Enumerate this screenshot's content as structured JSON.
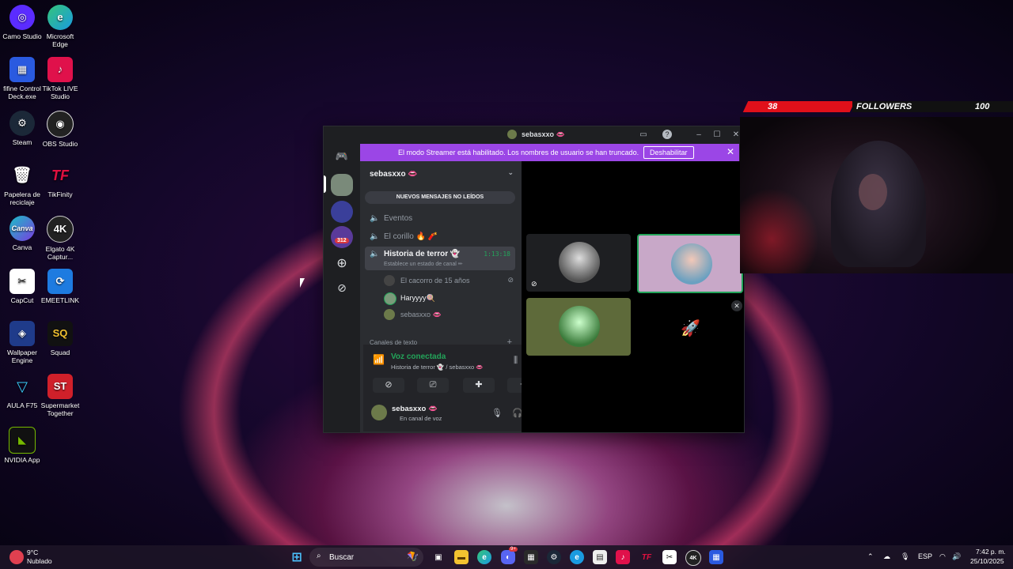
{
  "desktop": {
    "icons": [
      {
        "label": "Camo Studio",
        "bg": "#5b2cff",
        "glyph": "◎"
      },
      {
        "label": "Microsoft Edge",
        "bg": "#1a9be0",
        "glyph": "e"
      },
      {
        "label": "fifine Control Deck.exe",
        "bg": "#2a5ae0",
        "glyph": "▦"
      },
      {
        "label": "TikTok LIVE Studio",
        "bg": "#e0114b",
        "glyph": "♪"
      },
      {
        "label": "Steam",
        "bg": "#1b2838",
        "glyph": "⚙"
      },
      {
        "label": "OBS Studio",
        "bg": "#222",
        "glyph": "◉"
      },
      {
        "label": "Papelera de reciclaje",
        "bg": "#2a3a4a",
        "glyph": "🗑"
      },
      {
        "label": "TikFinity",
        "bg": "#111",
        "glyph": "TF"
      },
      {
        "label": "Canva",
        "bg": "#1ac0c6",
        "glyph": "C"
      },
      {
        "label": "Elgato 4K Captur...",
        "bg": "#222",
        "glyph": "4K"
      },
      {
        "label": "CapCut",
        "bg": "#111",
        "glyph": "✂"
      },
      {
        "label": "EMEETLINK",
        "bg": "#1e7be0",
        "glyph": "⟳"
      },
      {
        "label": "Wallpaper Engine",
        "bg": "#1f3b8a",
        "glyph": "◈"
      },
      {
        "label": "Squad",
        "bg": "#111",
        "glyph": "SQ"
      },
      {
        "label": "AULA F75",
        "bg": "#0a2a4a",
        "glyph": "▽"
      },
      {
        "label": "Supermarket Together",
        "bg": "#d0202a",
        "glyph": "ST"
      },
      {
        "label": "NVIDIA App",
        "bg": "#76b900",
        "glyph": "◣"
      }
    ]
  },
  "discord": {
    "window_title": "sebasxxo 👄",
    "banner": {
      "text": "El modo Streamer está habilitado. Los nombres de usuario se han truncado.",
      "button": "Deshabilitar"
    },
    "guild_badge": "312",
    "server_name": "sebasxxo 👄",
    "new_messages": "NUEVOS MENSAJES NO LEÍDOS",
    "channels": [
      {
        "name": "Eventos"
      },
      {
        "name": "El corillo 🔥 🧨"
      }
    ],
    "active_channel": {
      "name": "Historia de terror 👻",
      "timer": "1:13:18",
      "status": "Establece un estado de canal ✏"
    },
    "voice_users": [
      {
        "name": "El cacorro de 15 años",
        "color": "#444"
      },
      {
        "name": "Haryyyy🍭",
        "color": "#7a9a7a"
      },
      {
        "name": "sebasxxo 👄",
        "color": "#6c7a4a"
      }
    ],
    "text_category": "Canales de texto",
    "voice_panel": {
      "title": "Voz conectada",
      "subtitle": "Historia de terror 👻 / sebasxxo 👄"
    },
    "user": {
      "name": "sebasxxo 👄",
      "status": "En canal de voz"
    }
  },
  "overlay": {
    "left_count": "38",
    "label": "FOLLOWERS",
    "goal": "100"
  },
  "taskbar": {
    "weather_temp": "9°C",
    "weather_desc": "Nublado",
    "search_placeholder": "Buscar",
    "lang": "ESP",
    "time": "7:42 p. m.",
    "date": "25/10/2025",
    "discord_badge": "9+"
  }
}
